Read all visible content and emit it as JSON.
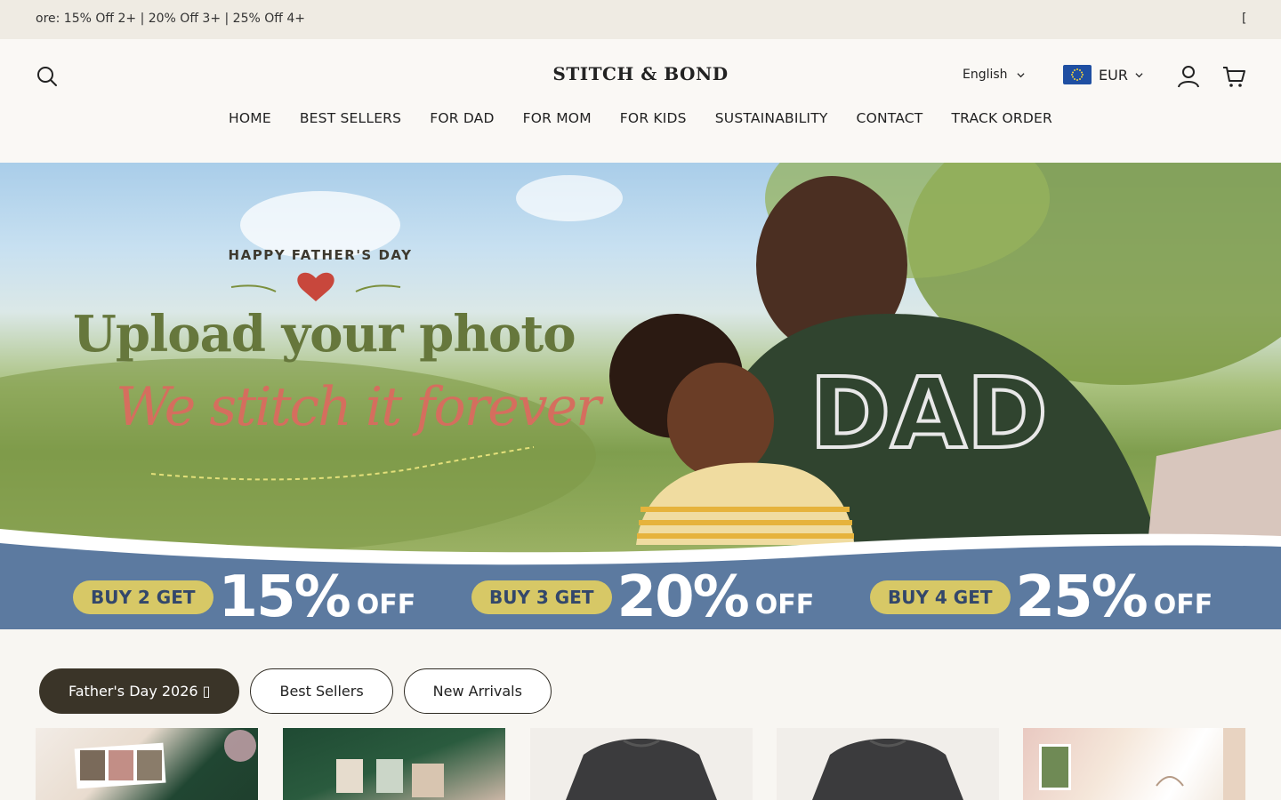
{
  "announcement": {
    "text": "ore: 15% Off 2+ | 20% Off 3+ | 25% Off 4+",
    "trailing_mark": "["
  },
  "header": {
    "logo": "STITCH & BOND",
    "language": "English",
    "currency": "EUR",
    "icons": [
      "search-icon",
      "user-icon",
      "cart-icon",
      "chevron-down-icon"
    ]
  },
  "nav": {
    "items": [
      "HOME",
      "BEST SELLERS",
      "FOR DAD",
      "FOR MOM",
      "FOR KIDS",
      "SUSTAINABILITY",
      "CONTACT",
      "TRACK ORDER"
    ]
  },
  "hero": {
    "tag": "HAPPY FATHER'S DAY",
    "title": "Upload your photo",
    "subtitle": "We stitch it forever",
    "offers": [
      {
        "pill": "BUY 2 GET",
        "pct": "15%",
        "off": "OFF"
      },
      {
        "pill": "BUY 3 GET",
        "pct": "20%",
        "off": "OFF"
      },
      {
        "pill": "BUY 4 GET",
        "pct": "25%",
        "off": "OFF"
      }
    ],
    "colors": {
      "offer_band": "#5c7aa0",
      "pill": "#d7c866",
      "title": "#66773c",
      "script": "#d56e5e"
    }
  },
  "tabs": {
    "items": [
      {
        "label": "Father's Day 2026 ▯",
        "active": true
      },
      {
        "label": "Best Sellers",
        "active": false
      },
      {
        "label": "New Arrivals",
        "active": false
      }
    ]
  },
  "products": {
    "count_visible": 5
  }
}
